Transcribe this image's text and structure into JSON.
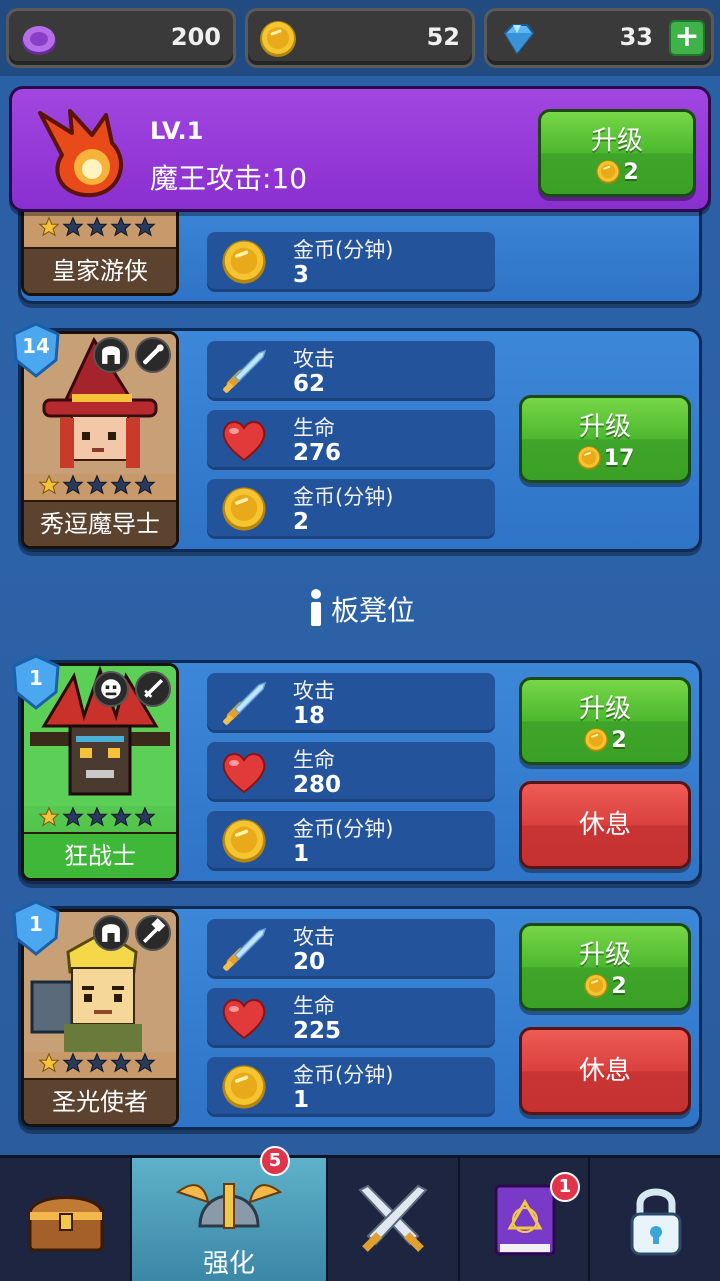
{
  "currencies": {
    "orb": {
      "value": "200",
      "icon": "purple-orb-icon"
    },
    "gold": {
      "value": "52",
      "icon": "gold-coin-icon"
    },
    "gem": {
      "value": "33",
      "icon": "diamond-icon"
    }
  },
  "boss": {
    "level": "LV.1",
    "attack": "魔王攻击:10",
    "upgrade_label": "升级",
    "upgrade_cost": "2"
  },
  "heroes": [
    {
      "name": "皇家游侠",
      "coin_label": "金币(分钟)",
      "coin": "3",
      "partial": true
    },
    {
      "name": "秀逗魔导士",
      "level": "14",
      "stars": 1,
      "attack_label": "攻击",
      "attack": "62",
      "hp_label": "生命",
      "hp": "276",
      "coin_label": "金币(分钟)",
      "coin": "2",
      "upgrade_label": "升级",
      "upgrade_cost": "17"
    }
  ],
  "bench_title": "板凳位",
  "bench": [
    {
      "name": "狂战士",
      "level": "1",
      "stars": 1,
      "attack_label": "攻击",
      "attack": "18",
      "hp_label": "生命",
      "hp": "280",
      "coin_label": "金币(分钟)",
      "coin": "1",
      "upgrade_label": "升级",
      "upgrade_cost": "2",
      "rest_label": "休息"
    },
    {
      "name": "圣光使者",
      "level": "1",
      "stars": 1,
      "attack_label": "攻击",
      "attack": "20",
      "hp_label": "生命",
      "hp": "225",
      "coin_label": "金币(分钟)",
      "coin": "1",
      "upgrade_label": "升级",
      "upgrade_cost": "2",
      "rest_label": "休息"
    }
  ],
  "nav": {
    "tabs": [
      {
        "icon": "treasure-chest-icon",
        "label": ""
      },
      {
        "icon": "winged-helmet-icon",
        "label": "强化",
        "badge": "5",
        "active": true
      },
      {
        "icon": "crossed-swords-icon",
        "label": ""
      },
      {
        "icon": "spellbook-icon",
        "label": "",
        "badge": "1"
      },
      {
        "icon": "padlock-icon",
        "label": ""
      }
    ]
  },
  "colors": {
    "panel": "#3d87d9",
    "green_button": "#4cb82f",
    "red_button": "#d9413f",
    "boss_banner": "#a146e0"
  }
}
